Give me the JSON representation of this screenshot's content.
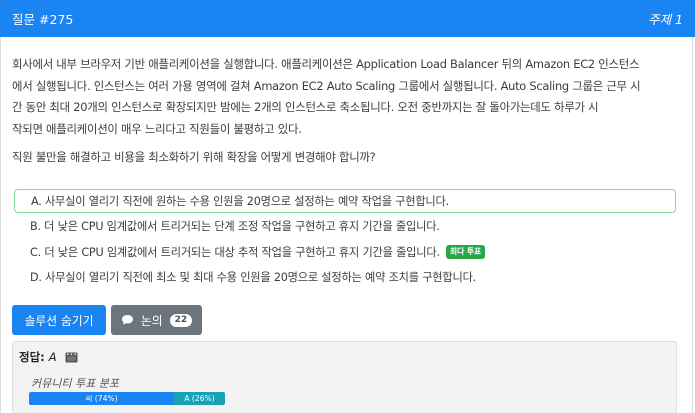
{
  "header": {
    "question_number": "질문 #275",
    "topic": "주제 1"
  },
  "question": {
    "body_lines": [
      "회사에서 내부 브라우저 기반 애플리케이션을 실행합니다. 애플리케이션은 Application Load Balancer 뒤의 Amazon EC2 인스턴스",
      "에서 실행됩니다. 인스턴스는 여러 가용 영역에 걸쳐 Amazon EC2 Auto Scaling 그룹에서 실행됩니다. Auto Scaling 그룹은 근무 시",
      "간 동안 최대 20개의 인스턴스로 확장되지만 밤에는 2개의 인스턴스로 축소됩니다. 오전 중반까지는 잘 돌아가는데도 하루가 시",
      "작되면 애플리케이션이 매우 느리다고 직원들이 불평하고 있다."
    ],
    "ask": "직원 불만을 해결하고 비용을 최소화하기 위해 확장을 어떻게 변경해야 합니까?"
  },
  "choices": [
    {
      "text": "A. 사무실이 열리기 직전에 원하는 수용 인원을 20명으로 설정하는 예약 작업을 구현합니다.",
      "badge": ""
    },
    {
      "text": "B. 더 낮은 CPU 임계값에서 트리거되는 단계 조정 작업을 구현하고 휴지 기간을 줄입니다.",
      "badge": ""
    },
    {
      "text": "C. 더 낮은 CPU 임계값에서 트리거되는 대상 추적 작업을 구현하고 휴지 기간을 줄입니다.",
      "badge": "최다 투표"
    },
    {
      "text": "D. 사무실이 열리기 직전에 최소 및 최대 수용 인원을 20명으로 설정하는 예약 조치를 구현합니다.",
      "badge": ""
    }
  ],
  "buttons": {
    "solution": "솔루션 숨기기",
    "discussion": "논의",
    "discussion_count": "22"
  },
  "answer": {
    "label": "정답:",
    "value": "A",
    "distribution_label": "커뮤니티 투표 분포",
    "votes": [
      {
        "label": "씨 (74%)",
        "share": 0.74,
        "color": "#1b84f3"
      },
      {
        "label": "A (26%)",
        "share": 0.26,
        "color": "#17a2b8"
      }
    ]
  },
  "icons": [
    "chat-bubble-icon",
    "film-icon"
  ]
}
